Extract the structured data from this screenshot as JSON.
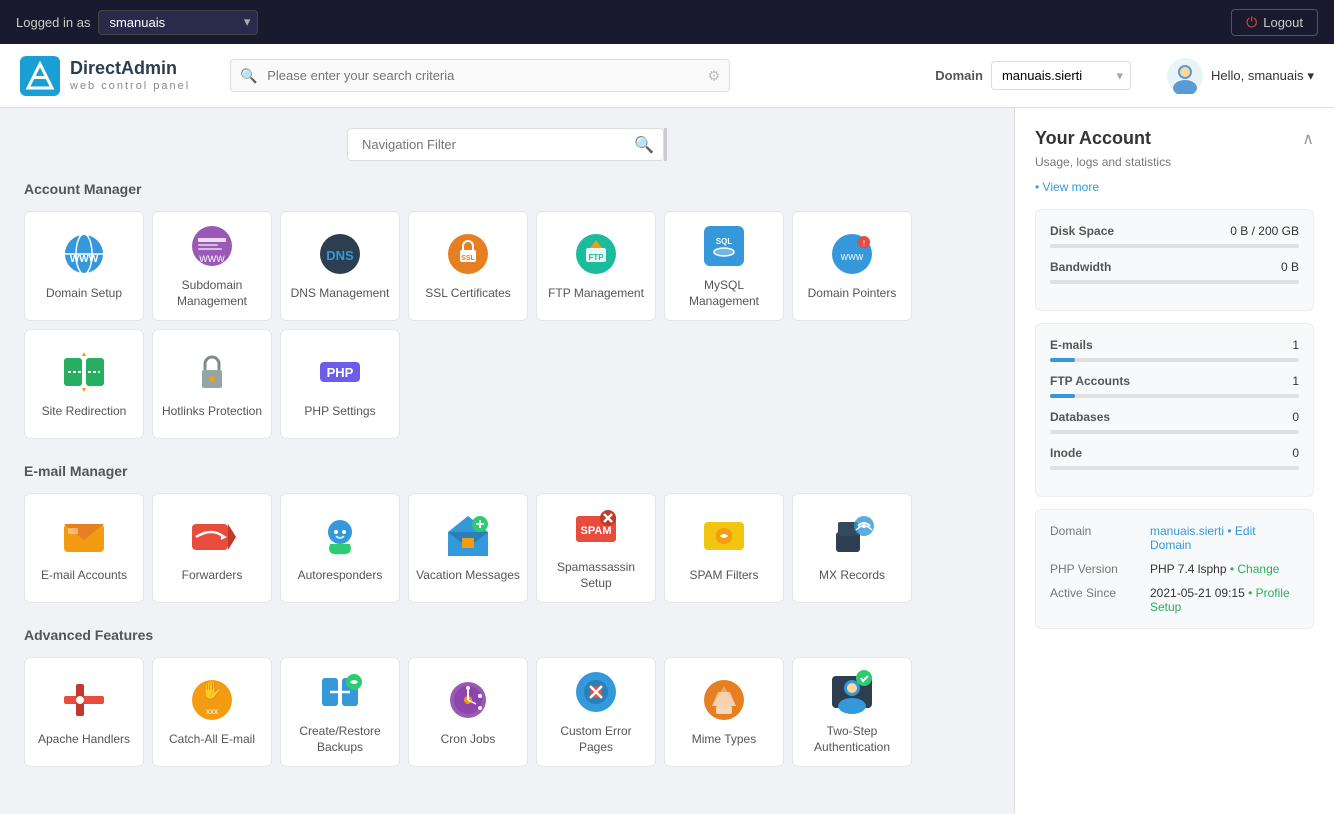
{
  "topbar": {
    "logged_in_as": "Logged in as",
    "username": "smanuais",
    "logout_label": "Logout"
  },
  "header": {
    "brand": "DirectAdmin",
    "sub": "web control panel",
    "search_placeholder": "Please enter your search criteria",
    "domain_label": "Domain",
    "domain_value": "manuais.sierti",
    "greeting": "Hello, smanuais"
  },
  "nav_filter": {
    "placeholder": "Navigation Filter"
  },
  "sections": [
    {
      "id": "account_manager",
      "title": "Account Manager",
      "items": [
        {
          "id": "domain-setup",
          "label": "Domain Setup",
          "emoji": "🌐"
        },
        {
          "id": "subdomain-mgmt",
          "label": "Subdomain Management",
          "emoji": "🌐"
        },
        {
          "id": "dns-mgmt",
          "label": "DNS Management",
          "emoji": "🔵"
        },
        {
          "id": "ssl-certs",
          "label": "SSL Certificates",
          "emoji": "🔒"
        },
        {
          "id": "ftp-mgmt",
          "label": "FTP Management",
          "emoji": "📁"
        },
        {
          "id": "mysql-mgmt",
          "label": "MySQL Management",
          "emoji": "🗄️"
        },
        {
          "id": "domain-pointers",
          "label": "Domain Pointers",
          "emoji": "🌐"
        },
        {
          "id": "site-redirection",
          "label": "Site Redirection",
          "emoji": "🔀"
        },
        {
          "id": "hotlinks-protection",
          "label": "Hotlinks Protection",
          "emoji": "🔐"
        },
        {
          "id": "php-settings",
          "label": "PHP Settings",
          "emoji": "🐘"
        }
      ]
    },
    {
      "id": "email_manager",
      "title": "E-mail Manager",
      "items": [
        {
          "id": "email-accounts",
          "label": "E-mail Accounts",
          "emoji": "✉️"
        },
        {
          "id": "forwarders",
          "label": "Forwarders",
          "emoji": "↩️"
        },
        {
          "id": "autoresponders",
          "label": "Autoresponders",
          "emoji": "📡"
        },
        {
          "id": "vacation-messages",
          "label": "Vacation Messages",
          "emoji": "✈️"
        },
        {
          "id": "spamassassin-setup",
          "label": "Spamassassin Setup",
          "emoji": "🚫"
        },
        {
          "id": "spam-filters",
          "label": "SPAM Filters",
          "emoji": "📧"
        },
        {
          "id": "mx-records",
          "label": "MX Records",
          "emoji": "📶"
        }
      ]
    },
    {
      "id": "advanced_features",
      "title": "Advanced Features",
      "items": [
        {
          "id": "apache-handlers",
          "label": "Apache Handlers",
          "emoji": "🔧"
        },
        {
          "id": "catch-all-email",
          "label": "Catch-All E-mail",
          "emoji": "📬"
        },
        {
          "id": "create-restore-backups",
          "label": "Create/Restore Backups",
          "emoji": "💻"
        },
        {
          "id": "cron-jobs",
          "label": "Cron Jobs",
          "emoji": "🤖"
        },
        {
          "id": "custom-error-pages",
          "label": "Custom Error Pages",
          "emoji": "⚙️"
        },
        {
          "id": "mime-types",
          "label": "Mime Types",
          "emoji": "🎬"
        },
        {
          "id": "two-step-auth",
          "label": "Two-Step Authentication",
          "emoji": "👤"
        }
      ]
    }
  ],
  "right_panel": {
    "title": "Your Account",
    "subtitle": "Usage, logs and statistics",
    "view_more": "• View more",
    "disk_space": {
      "label": "Disk Space",
      "value": "0 B / 200 GB",
      "percent": 0
    },
    "bandwidth": {
      "label": "Bandwidth",
      "value": "0 B",
      "percent": 0
    },
    "stats": [
      {
        "label": "E-mails",
        "value": "1",
        "percent": 10
      },
      {
        "label": "FTP Accounts",
        "value": "1",
        "percent": 10
      },
      {
        "label": "Databases",
        "value": "0",
        "percent": 0
      },
      {
        "label": "Inode",
        "value": "0",
        "percent": 0
      }
    ],
    "domain_info": {
      "domain_label": "Domain",
      "domain_value": "manuais.sierti",
      "edit_domain": "• Edit Domain",
      "php_version_label": "PHP Version",
      "php_version_value": "PHP 7.4 lsphp",
      "php_change": "• Change",
      "active_since_label": "Active Since",
      "active_since_value": "2021-05-21 09:15",
      "profile_setup": "• Profile Setup"
    }
  }
}
